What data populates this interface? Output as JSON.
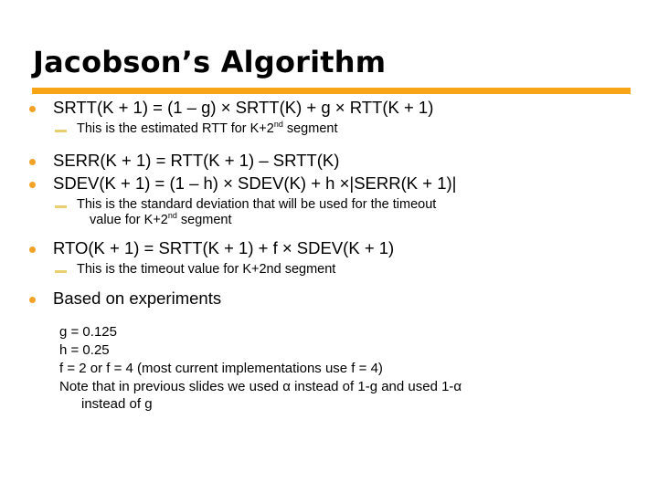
{
  "slide": {
    "title": "Jacobson’s Algorithm",
    "accent_color": "#F7A417",
    "bullet_color": "#F2A227",
    "dash_color": "#E8CF70",
    "text_color": "#000000",
    "background_color": "#FFFFFF",
    "bullets": {
      "srtt": "SRTT(K + 1) = (1 – g) × SRTT(K) + g × RTT(K + 1)",
      "srtt_note_pre": "This is the estimated RTT for K+2",
      "srtt_note_sup": "nd",
      "srtt_note_post": " segment",
      "serr": "SERR(K + 1) = RTT(K + 1) – SRTT(K)",
      "sdev": "SDEV(K + 1) = (1 – h) × SDEV(K) + h ×|SERR(K + 1)|",
      "sdev_note_pre": "This is the standard deviation that will be used for the timeout",
      "sdev_note_line2_pre": "value for K+2",
      "sdev_note_sup": "nd",
      "sdev_note_post": " segment",
      "rto": "RTO(K + 1) = SRTT(K + 1) + f × SDEV(K + 1)",
      "rto_note": "This is the timeout value for K+2nd segment",
      "experiments": "Based on experiments"
    },
    "parameters": {
      "g": "g = 0.125",
      "h": "h = 0.25",
      "f": "f = 2  or  f = 4   (most current implementations use f = 4)",
      "note_line1": "Note that in previous slides we used α instead of 1-g and used 1-α",
      "note_line2": "instead of g"
    }
  }
}
